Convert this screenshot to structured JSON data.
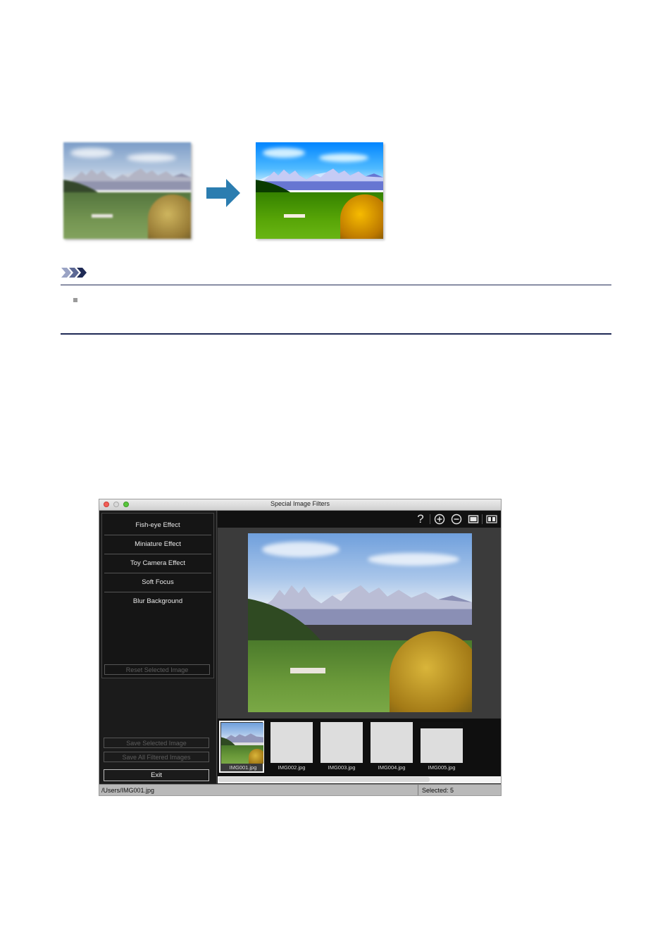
{
  "comparison": {
    "before_image": "landscape-original",
    "after_image": "landscape-vivid",
    "arrow_color": "#2b7db0"
  },
  "note": {
    "icon": "note-chevrons-icon",
    "accent": "#1f2a55"
  },
  "window": {
    "title": "Special Image Filters",
    "filters": [
      {
        "label": "Fish-eye Effect"
      },
      {
        "label": "Miniature Effect"
      },
      {
        "label": "Toy Camera Effect"
      },
      {
        "label": "Soft Focus"
      },
      {
        "label": "Blur Background"
      }
    ],
    "reset_label": "Reset Selected Image",
    "save_selected_label": "Save Selected Image",
    "save_all_label": "Save All Filtered Images",
    "exit_label": "Exit",
    "toolbar": {
      "help": "?",
      "icons": [
        "help-icon",
        "zoom-in-icon",
        "zoom-out-icon",
        "full-screen-icon",
        "compare-icon"
      ]
    },
    "thumbnails": [
      {
        "name": "IMG001.jpg",
        "selected": true
      },
      {
        "name": "IMG002.jpg",
        "selected": false
      },
      {
        "name": "IMG003.jpg",
        "selected": false
      },
      {
        "name": "IMG004.jpg",
        "selected": false
      },
      {
        "name": "IMG005.jpg",
        "selected": false
      }
    ],
    "status": {
      "path": "/Users/IMG001.jpg",
      "selected": "Selected: 5"
    }
  }
}
